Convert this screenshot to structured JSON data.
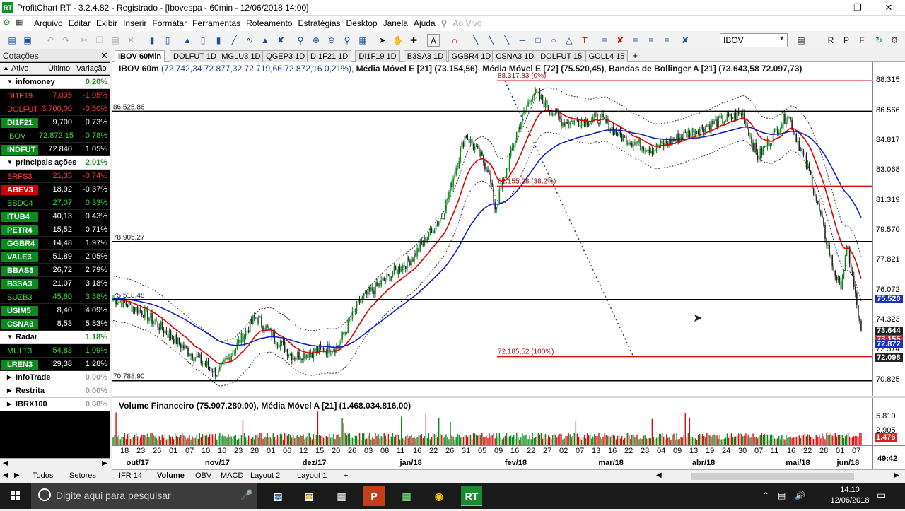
{
  "window": {
    "title": "ProfitChart RT - 3.2.4.82 - Registrado - [Ibovespa - 60min - 12/06/2018 14:00]",
    "app_icon": "RT"
  },
  "menu": [
    "Arquivo",
    "Editar",
    "Exibir",
    "Inserir",
    "Formatar",
    "Ferramentas",
    "Roteamento",
    "Estratégias",
    "Desktop",
    "Janela",
    "Ajuda"
  ],
  "menu_live": "Ao Vivo",
  "toolbar": {
    "symbol": "IBOV"
  },
  "quotes_panel": {
    "title": "Cotações",
    "columns": [
      "Ativo",
      "Último",
      "Variação"
    ],
    "groups": [
      {
        "name": "infomoney",
        "var": "0,20%",
        "var_color": "#1a8a1a",
        "rows": [
          {
            "s": "DI1F19",
            "l": "7,095",
            "v": "-1,05%",
            "bg": "#000",
            "fg": "#ff3b3b"
          },
          {
            "s": "DOLFUT",
            "l": "3.700,00",
            "v": "-0,50%",
            "bg": "#000",
            "fg": "#ff3b3b"
          },
          {
            "s": "DI1F21",
            "l": "9,700",
            "v": "0,73%",
            "bg": "#0b8a1e",
            "fg": "#fff"
          },
          {
            "s": "IBOV",
            "l": "72.872,15",
            "v": "0,78%",
            "bg": "#000",
            "fg": "#3bdc3b"
          },
          {
            "s": "INDFUT",
            "l": "72.840",
            "v": "1,05%",
            "bg": "#0b8a1e",
            "fg": "#fff"
          }
        ]
      },
      {
        "name": "principais ações",
        "var": "2,01%",
        "var_color": "#1a8a1a",
        "rows": [
          {
            "s": "BRFS3",
            "l": "21,35",
            "v": "-0,74%",
            "bg": "#000",
            "fg": "#ff3b3b"
          },
          {
            "s": "ABEV3",
            "l": "18,92",
            "v": "-0,37%",
            "bg": "#cc0000",
            "fg": "#fff"
          },
          {
            "s": "BBDC4",
            "l": "27,07",
            "v": "0,33%",
            "bg": "#000",
            "fg": "#3bdc3b"
          },
          {
            "s": "ITUB4",
            "l": "40,13",
            "v": "0,43%",
            "bg": "#0b8a1e",
            "fg": "#fff"
          },
          {
            "s": "PETR4",
            "l": "15,52",
            "v": "0,71%",
            "bg": "#0b8a1e",
            "fg": "#fff"
          },
          {
            "s": "GGBR4",
            "l": "14,48",
            "v": "1,97%",
            "bg": "#0b8a1e",
            "fg": "#fff"
          },
          {
            "s": "VALE3",
            "l": "51,89",
            "v": "2,05%",
            "bg": "#0b8a1e",
            "fg": "#fff"
          },
          {
            "s": "BBAS3",
            "l": "26,72",
            "v": "2,79%",
            "bg": "#0b8a1e",
            "fg": "#fff"
          },
          {
            "s": "B3SA3",
            "l": "21,07",
            "v": "3,18%",
            "bg": "#0b8a1e",
            "fg": "#fff"
          },
          {
            "s": "SUZB3",
            "l": "45,80",
            "v": "3,88%",
            "bg": "#000",
            "fg": "#3bdc3b"
          },
          {
            "s": "USIM5",
            "l": "8,40",
            "v": "4,09%",
            "bg": "#0b8a1e",
            "fg": "#fff"
          },
          {
            "s": "CSNA3",
            "l": "8,53",
            "v": "5,83%",
            "bg": "#0b8a1e",
            "fg": "#fff"
          }
        ]
      },
      {
        "name": "Radar",
        "var": "1,18%",
        "var_color": "#1a8a1a",
        "rows": [
          {
            "s": "MULT3",
            "l": "54,83",
            "v": "1,09%",
            "bg": "#000",
            "fg": "#3bdc3b"
          },
          {
            "s": "LREN3",
            "l": "29,38",
            "v": "1,28%",
            "bg": "#0b8a1e",
            "fg": "#fff"
          }
        ]
      },
      {
        "name": "InfoTrade",
        "var": "0,00%",
        "var_color": "#999",
        "rows": []
      },
      {
        "name": "Restrita",
        "var": "0,00%",
        "var_color": "#999",
        "rows": []
      },
      {
        "name": "IBRX100",
        "var": "0,00%",
        "var_color": "#999",
        "rows": []
      }
    ],
    "footer_tabs": [
      "Todos",
      "Setores"
    ]
  },
  "chart_tabs": [
    "IBOV 60Min",
    "DOLFUT 1D",
    "MGLU3 1D",
    "QGEP3 1D",
    "DI1F21 1D",
    "DI1F19 1D",
    "B3SA3 1D",
    "GGBR4 1D",
    "CSNA3 1D",
    "DOLFUT 15",
    "GOLL4 15"
  ],
  "chart": {
    "header_prefix": "IBOV 60m",
    "header_ohlc": "(72.742,34  72.877,32  72.719,66  72.872,16  0,21%)",
    "header_ma1": "Média Móvel E [21] (73.154,56)",
    "header_ma2": "Média Móvel E [72] (75.520,45)",
    "header_bb": "Bandas de Bollinger A [21] (73.643,58  72.097,73)",
    "hlines": [
      {
        "label": "86.525,86",
        "price": 86525.86
      },
      {
        "label": "78.905,27",
        "price": 78905.27
      },
      {
        "label": "75.518,48",
        "price": 75518.48
      },
      {
        "label": "70.788,90",
        "price": 70788.9
      }
    ],
    "fib_lines": [
      {
        "label": "88.317,83 (0%)",
        "price": 88317.83
      },
      {
        "label": "82.155,28 (38,2%)",
        "price": 82155.28
      },
      {
        "label": "72.185,52 (100%)",
        "price": 72185.52
      }
    ],
    "price_ticks": [
      "88.315",
      "86.566",
      "84.817",
      "83.068",
      "81.319",
      "79.570",
      "77.821",
      "76.072",
      "74.323",
      "72.574",
      "70.825"
    ],
    "price_badges": [
      {
        "text": "75.520",
        "bg": "#1c2fc4",
        "price": 75520
      },
      {
        "text": "73.644",
        "bg": "#222",
        "price": 73644
      },
      {
        "text": "73.155",
        "bg": "#d42020",
        "price": 73155
      },
      {
        "text": "72.872",
        "bg": "#1c2fc4",
        "price": 72872
      },
      {
        "text": "72.098",
        "bg": "#222",
        "price": 72098
      }
    ],
    "y_min": 69900,
    "y_max": 89400
  },
  "volume": {
    "header": "Volume Financeiro (75.907.280,00), Média Móvel A [21] (1.468.034.816,00)",
    "ticks": [
      "5.810",
      "2.905"
    ],
    "badge": "1.476"
  },
  "date_axis": {
    "days": [
      "18",
      "23",
      "26",
      "01",
      "07",
      "10",
      "16",
      "23",
      "28",
      "01",
      "06",
      "12",
      "15",
      "20",
      "26",
      "03",
      "08",
      "11",
      "16",
      "22",
      "26",
      "31",
      "05",
      "09",
      "16",
      "22",
      "27",
      "02",
      "07",
      "13",
      "16",
      "22",
      "28",
      "04",
      "09",
      "13",
      "19",
      "24",
      "30",
      "07",
      "11",
      "16",
      "22",
      "28",
      "01",
      "07"
    ],
    "months": [
      {
        "label": "out/17",
        "pos": 0.01
      },
      {
        "label": "nov/17",
        "pos": 0.115
      },
      {
        "label": "dez/17",
        "pos": 0.245
      },
      {
        "label": "jan/18",
        "pos": 0.375
      },
      {
        "label": "fev/18",
        "pos": 0.515
      },
      {
        "label": "mar/18",
        "pos": 0.64
      },
      {
        "label": "abr/18",
        "pos": 0.765
      },
      {
        "label": "mai/18",
        "pos": 0.89
      },
      {
        "label": "jun/18",
        "pos": 0.958
      }
    ],
    "corner": "49:42"
  },
  "bottom_tabs": [
    "IFR 14",
    "Volume",
    "OBV",
    "MACD",
    "Layout 2",
    "Layout 1"
  ],
  "taskbar": {
    "search_placeholder": "Digite aqui para pesquisar",
    "time": "14:10",
    "date": "12/06/2018",
    "active_app": "RT"
  }
}
